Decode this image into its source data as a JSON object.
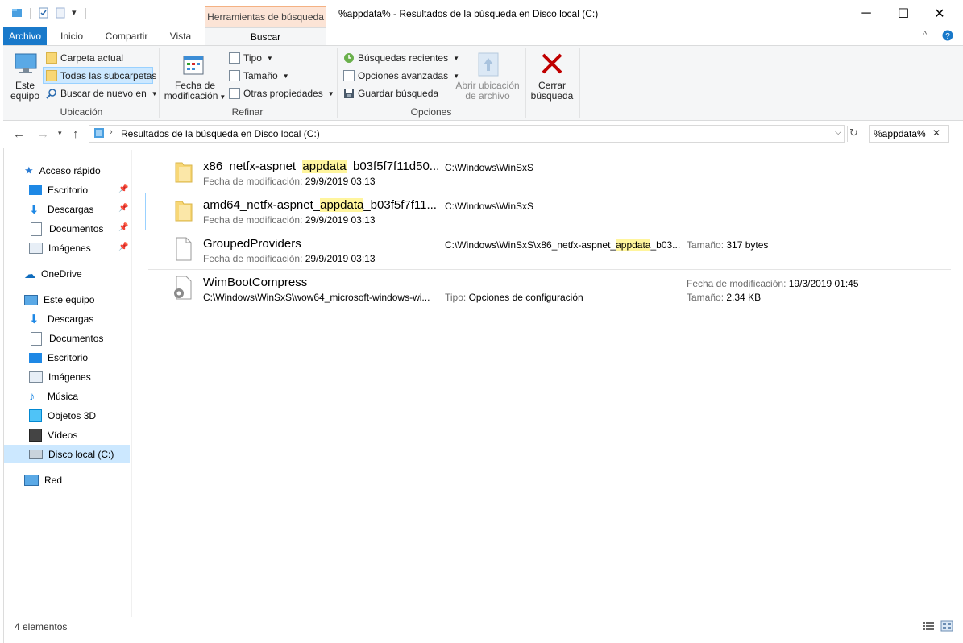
{
  "window": {
    "title": "%appdata% - Resultados de la búsqueda en Disco local (C:)",
    "context_group": "Herramientas de búsqueda",
    "controls": {
      "minimize": "─",
      "maximize": "☐",
      "close": "✕"
    }
  },
  "tabs": {
    "archivo": "Archivo",
    "inicio": "Inicio",
    "compartir": "Compartir",
    "vista": "Vista",
    "buscar": "Buscar"
  },
  "ribbon": {
    "ubicacion": {
      "label": "Ubicación",
      "este_equipo_1": "Este",
      "este_equipo_2": "equipo",
      "carpeta_actual": "Carpeta actual",
      "todas_subcarpetas": "Todas las subcarpetas",
      "buscar_de_nuevo": "Buscar de nuevo en"
    },
    "refinar": {
      "label": "Refinar",
      "fecha_1": "Fecha de",
      "fecha_2": "modificación",
      "tipo": "Tipo",
      "tamano": "Tamaño",
      "otras": "Otras propiedades"
    },
    "opciones": {
      "label": "Opciones",
      "recientes": "Búsquedas recientes",
      "avanzadas": "Opciones avanzadas",
      "guardar": "Guardar búsqueda",
      "abrir_1": "Abrir ubicación",
      "abrir_2": "de archivo",
      "cerrar_1": "Cerrar",
      "cerrar_2": "búsqueda"
    }
  },
  "address": {
    "path": "Resultados de la búsqueda en Disco local (C:)",
    "search_value": "%appdata%"
  },
  "nav": {
    "acceso_rapido": "Acceso rápido",
    "quick": [
      "Escritorio",
      "Descargas",
      "Documentos",
      "Imágenes"
    ],
    "onedrive": "OneDrive",
    "este_equipo": "Este equipo",
    "pc": [
      "Descargas",
      "Documentos",
      "Escritorio",
      "Imágenes",
      "Música",
      "Objetos 3D",
      "Vídeos",
      "Disco local (C:)"
    ],
    "red": "Red"
  },
  "results": [
    {
      "name_pre": "x86_netfx-aspnet_",
      "name_hl": "appdata",
      "name_post": "_b03f5f7f11d50...",
      "meta_label": "Fecha de modificación:",
      "meta_value": "29/9/2019 03:13",
      "path": "C:\\Windows\\WinSxS"
    },
    {
      "name_pre": "amd64_netfx-aspnet_",
      "name_hl": "appdata",
      "name_post": "_b03f5f7f11...",
      "meta_label": "Fecha de modificación:",
      "meta_value": "29/9/2019 03:13",
      "path": "C:\\Windows\\WinSxS"
    },
    {
      "name": "GroupedProviders",
      "meta_label": "Fecha de modificación:",
      "meta_value": "29/9/2019 03:13",
      "path_pre": "C:\\Windows\\WinSxS\\x86_netfx-aspnet_",
      "path_hl": "appdata",
      "path_post": "_b03...",
      "size_label": "Tamaño:",
      "size_value": "317 bytes"
    },
    {
      "name": "WimBootCompress",
      "path": "C:\\Windows\\WinSxS\\wow64_microsoft-windows-wi...",
      "type_label": "Tipo:",
      "type_value": "Opciones de configuración",
      "date_label": "Fecha de modificación:",
      "date_value": "19/3/2019 01:45",
      "size_label": "Tamaño:",
      "size_value": "2,34 KB"
    }
  ],
  "status": {
    "count": "4 elementos"
  },
  "colors": {
    "accent": "#1979ca",
    "context_tab": "#fce4d6",
    "selection": "#cce8ff",
    "highlight": "#fff59d",
    "close_x": "#c00000"
  }
}
